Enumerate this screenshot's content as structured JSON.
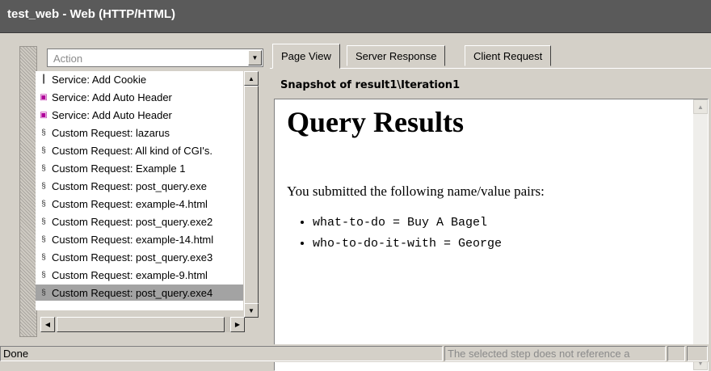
{
  "window": {
    "title": "test_web - Web (HTTP/HTML)"
  },
  "left_panel": {
    "combo": {
      "value": "Action"
    },
    "steps": [
      {
        "label": "Service: Add Cookie",
        "icon": "cookie-icon"
      },
      {
        "label": "Service: Add Auto Header",
        "icon": "header-icon"
      },
      {
        "label": "Service: Add Auto Header",
        "icon": "header-icon"
      },
      {
        "label": "Custom Request: lazarus",
        "icon": "request-icon"
      },
      {
        "label": "Custom Request: All kind of CGI's.",
        "icon": "request-icon"
      },
      {
        "label": "Custom Request: Example 1",
        "icon": "request-icon"
      },
      {
        "label": "Custom Request: post_query.exe",
        "icon": "request-icon"
      },
      {
        "label": "Custom Request: example-4.html",
        "icon": "request-icon"
      },
      {
        "label": "Custom Request: post_query.exe2",
        "icon": "request-icon"
      },
      {
        "label": "Custom Request: example-14.html",
        "icon": "request-icon"
      },
      {
        "label": "Custom Request: post_query.exe3",
        "icon": "request-icon"
      },
      {
        "label": "Custom Request: example-9.html",
        "icon": "request-icon"
      },
      {
        "label": "Custom Request: post_query.exe4",
        "icon": "request-icon",
        "selected": true
      }
    ]
  },
  "right_panel": {
    "tabs": [
      "Page View",
      "Server Response",
      "Client Request"
    ],
    "active_tab": "Page View",
    "snapshot_title": "Snapshot of result1\\Iteration1",
    "page": {
      "heading": "Query Results",
      "intro": "You submitted the following name/value pairs:",
      "pairs": [
        "what-to-do = Buy A Bagel",
        "who-to-do-it-with = George"
      ]
    }
  },
  "status": {
    "left": "Done",
    "right": "The selected step does not reference a"
  },
  "colors": {
    "titlebar": "#5a5a5a",
    "chrome": "#d4d0c8",
    "selected_row": "#a3a3a3",
    "header_icon": "#b0009a"
  }
}
